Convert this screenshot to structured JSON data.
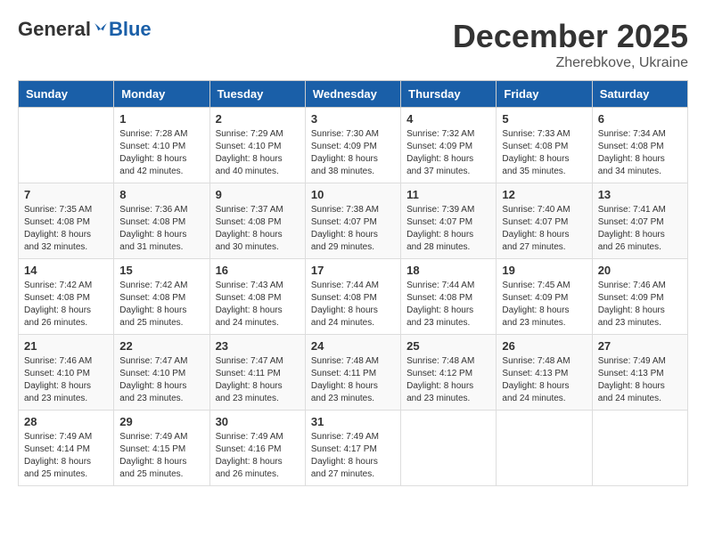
{
  "header": {
    "logo_general": "General",
    "logo_blue": "Blue",
    "month_title": "December 2025",
    "location": "Zherebkove, Ukraine"
  },
  "weekdays": [
    "Sunday",
    "Monday",
    "Tuesday",
    "Wednesday",
    "Thursday",
    "Friday",
    "Saturday"
  ],
  "weeks": [
    [
      {
        "day": "",
        "info": ""
      },
      {
        "day": "1",
        "info": "Sunrise: 7:28 AM\nSunset: 4:10 PM\nDaylight: 8 hours\nand 42 minutes."
      },
      {
        "day": "2",
        "info": "Sunrise: 7:29 AM\nSunset: 4:10 PM\nDaylight: 8 hours\nand 40 minutes."
      },
      {
        "day": "3",
        "info": "Sunrise: 7:30 AM\nSunset: 4:09 PM\nDaylight: 8 hours\nand 38 minutes."
      },
      {
        "day": "4",
        "info": "Sunrise: 7:32 AM\nSunset: 4:09 PM\nDaylight: 8 hours\nand 37 minutes."
      },
      {
        "day": "5",
        "info": "Sunrise: 7:33 AM\nSunset: 4:08 PM\nDaylight: 8 hours\nand 35 minutes."
      },
      {
        "day": "6",
        "info": "Sunrise: 7:34 AM\nSunset: 4:08 PM\nDaylight: 8 hours\nand 34 minutes."
      }
    ],
    [
      {
        "day": "7",
        "info": "Sunrise: 7:35 AM\nSunset: 4:08 PM\nDaylight: 8 hours\nand 32 minutes."
      },
      {
        "day": "8",
        "info": "Sunrise: 7:36 AM\nSunset: 4:08 PM\nDaylight: 8 hours\nand 31 minutes."
      },
      {
        "day": "9",
        "info": "Sunrise: 7:37 AM\nSunset: 4:08 PM\nDaylight: 8 hours\nand 30 minutes."
      },
      {
        "day": "10",
        "info": "Sunrise: 7:38 AM\nSunset: 4:07 PM\nDaylight: 8 hours\nand 29 minutes."
      },
      {
        "day": "11",
        "info": "Sunrise: 7:39 AM\nSunset: 4:07 PM\nDaylight: 8 hours\nand 28 minutes."
      },
      {
        "day": "12",
        "info": "Sunrise: 7:40 AM\nSunset: 4:07 PM\nDaylight: 8 hours\nand 27 minutes."
      },
      {
        "day": "13",
        "info": "Sunrise: 7:41 AM\nSunset: 4:07 PM\nDaylight: 8 hours\nand 26 minutes."
      }
    ],
    [
      {
        "day": "14",
        "info": "Sunrise: 7:42 AM\nSunset: 4:08 PM\nDaylight: 8 hours\nand 26 minutes."
      },
      {
        "day": "15",
        "info": "Sunrise: 7:42 AM\nSunset: 4:08 PM\nDaylight: 8 hours\nand 25 minutes."
      },
      {
        "day": "16",
        "info": "Sunrise: 7:43 AM\nSunset: 4:08 PM\nDaylight: 8 hours\nand 24 minutes."
      },
      {
        "day": "17",
        "info": "Sunrise: 7:44 AM\nSunset: 4:08 PM\nDaylight: 8 hours\nand 24 minutes."
      },
      {
        "day": "18",
        "info": "Sunrise: 7:44 AM\nSunset: 4:08 PM\nDaylight: 8 hours\nand 23 minutes."
      },
      {
        "day": "19",
        "info": "Sunrise: 7:45 AM\nSunset: 4:09 PM\nDaylight: 8 hours\nand 23 minutes."
      },
      {
        "day": "20",
        "info": "Sunrise: 7:46 AM\nSunset: 4:09 PM\nDaylight: 8 hours\nand 23 minutes."
      }
    ],
    [
      {
        "day": "21",
        "info": "Sunrise: 7:46 AM\nSunset: 4:10 PM\nDaylight: 8 hours\nand 23 minutes."
      },
      {
        "day": "22",
        "info": "Sunrise: 7:47 AM\nSunset: 4:10 PM\nDaylight: 8 hours\nand 23 minutes."
      },
      {
        "day": "23",
        "info": "Sunrise: 7:47 AM\nSunset: 4:11 PM\nDaylight: 8 hours\nand 23 minutes."
      },
      {
        "day": "24",
        "info": "Sunrise: 7:48 AM\nSunset: 4:11 PM\nDaylight: 8 hours\nand 23 minutes."
      },
      {
        "day": "25",
        "info": "Sunrise: 7:48 AM\nSunset: 4:12 PM\nDaylight: 8 hours\nand 23 minutes."
      },
      {
        "day": "26",
        "info": "Sunrise: 7:48 AM\nSunset: 4:13 PM\nDaylight: 8 hours\nand 24 minutes."
      },
      {
        "day": "27",
        "info": "Sunrise: 7:49 AM\nSunset: 4:13 PM\nDaylight: 8 hours\nand 24 minutes."
      }
    ],
    [
      {
        "day": "28",
        "info": "Sunrise: 7:49 AM\nSunset: 4:14 PM\nDaylight: 8 hours\nand 25 minutes."
      },
      {
        "day": "29",
        "info": "Sunrise: 7:49 AM\nSunset: 4:15 PM\nDaylight: 8 hours\nand 25 minutes."
      },
      {
        "day": "30",
        "info": "Sunrise: 7:49 AM\nSunset: 4:16 PM\nDaylight: 8 hours\nand 26 minutes."
      },
      {
        "day": "31",
        "info": "Sunrise: 7:49 AM\nSunset: 4:17 PM\nDaylight: 8 hours\nand 27 minutes."
      },
      {
        "day": "",
        "info": ""
      },
      {
        "day": "",
        "info": ""
      },
      {
        "day": "",
        "info": ""
      }
    ]
  ]
}
